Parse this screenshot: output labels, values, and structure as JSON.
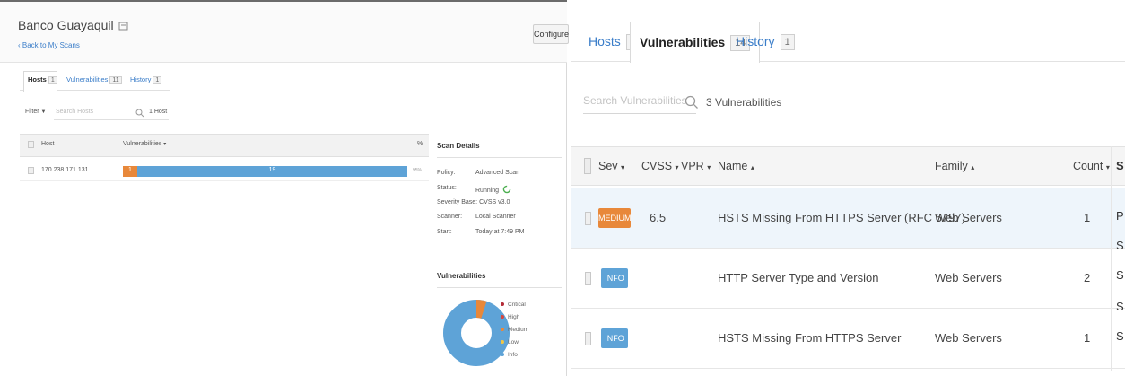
{
  "left": {
    "title": "Banco Guayaquil",
    "back_link": "‹ Back to My Scans",
    "configure_label": "Configure",
    "tabs": [
      {
        "label": "Hosts",
        "count": "1"
      },
      {
        "label": "Vulnerabilities",
        "count": "11"
      },
      {
        "label": "History",
        "count": "1"
      }
    ],
    "filter_label": "Filter",
    "search_placeholder": "Search Hosts",
    "host_count": "1 Host",
    "columns": {
      "host": "Host",
      "vulnerabilities": "Vulnerabilities",
      "percent": "%"
    },
    "rows": [
      {
        "host": "170.238.171.131",
        "medium": "1",
        "info": "19",
        "percent": "95%",
        "medium_share": 0.05
      }
    ],
    "scan_details": {
      "title": "Scan Details",
      "items": [
        {
          "label": "Policy:",
          "value": "Advanced Scan"
        },
        {
          "label": "Status:",
          "value": "Running"
        },
        {
          "label": "Severity Base:",
          "value": "CVSS v3.0"
        },
        {
          "label": "Scanner:",
          "value": "Local Scanner"
        },
        {
          "label": "Start:",
          "value": "Today at 7:49 PM"
        }
      ]
    },
    "vuln_chart": {
      "title": "Vulnerabilities",
      "legend": [
        {
          "label": "Critical",
          "color": "#b42b37"
        },
        {
          "label": "High",
          "color": "#d9453c"
        },
        {
          "label": "Medium",
          "color": "#e8883a"
        },
        {
          "label": "Low",
          "color": "#f2c744"
        },
        {
          "label": "Info",
          "color": "#5ea3d7"
        }
      ]
    }
  },
  "right": {
    "tabs": [
      {
        "label": "Hosts",
        "count": "1"
      },
      {
        "label": "Vulnerabilities",
        "count": "14"
      },
      {
        "label": "History",
        "count": "1"
      }
    ],
    "search_placeholder": "Search Vulnerabilities",
    "result_count": "3 Vulnerabilities",
    "columns": {
      "sev": "Sev",
      "cvss": "CVSS",
      "vpr": "VPR",
      "name": "Name",
      "family": "Family",
      "count": "Count"
    },
    "rows": [
      {
        "sev": "MEDIUM",
        "sev_color": "#e8883a",
        "cvss": "6.5",
        "name": "HSTS Missing From HTTPS Server (RFC 6797)",
        "family": "Web Servers",
        "count": "1"
      },
      {
        "sev": "INFO",
        "sev_color": "#5ea3d7",
        "cvss": "",
        "name": "HTTP Server Type and Version",
        "family": "Web Servers",
        "count": "2"
      },
      {
        "sev": "INFO",
        "sev_color": "#5ea3d7",
        "cvss": "",
        "name": "HSTS Missing From HTTPS Server",
        "family": "Web Servers",
        "count": "1"
      }
    ],
    "side_cut_letters": [
      "S",
      "P",
      "S",
      "S",
      "S",
      "S"
    ]
  }
}
